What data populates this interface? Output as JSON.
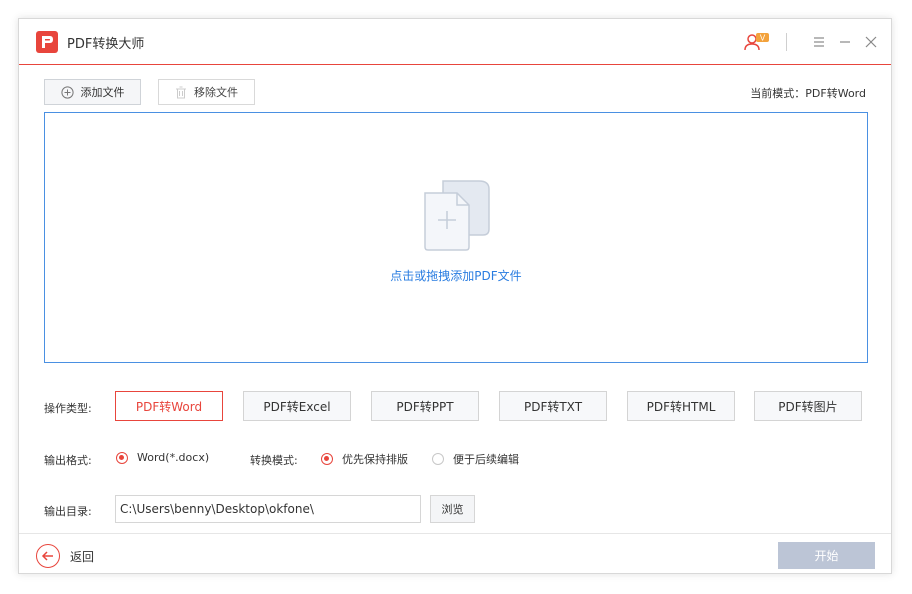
{
  "app": {
    "title": "PDF转换大师",
    "accent_color": "#e8453c",
    "vip_badge": "V"
  },
  "toolbar": {
    "add_file_label": "添加文件",
    "remove_file_label": "移除文件",
    "mode_info": "当前模式：PDF转Word"
  },
  "dropzone": {
    "hint": "点击或拖拽添加PDF文件",
    "icon": "add-file-icon"
  },
  "operation": {
    "label": "操作类型:",
    "types": [
      "PDF转Word",
      "PDF转Excel",
      "PDF转PPT",
      "PDF转TXT",
      "PDF转HTML",
      "PDF转图片"
    ],
    "selected": "PDF转Word"
  },
  "output_format": {
    "label": "输出格式:",
    "option": "Word(*.docx)"
  },
  "convert_mode": {
    "label": "转换模式:",
    "options": [
      "优先保持排版",
      "便于后续编辑"
    ],
    "selected": "优先保持排版"
  },
  "output_dir": {
    "label": "输出目录:",
    "value": "C:\\Users\\benny\\Desktop\\okfone\\",
    "browse_label": "浏览"
  },
  "footer": {
    "back_label": "返回",
    "start_label": "开始"
  }
}
